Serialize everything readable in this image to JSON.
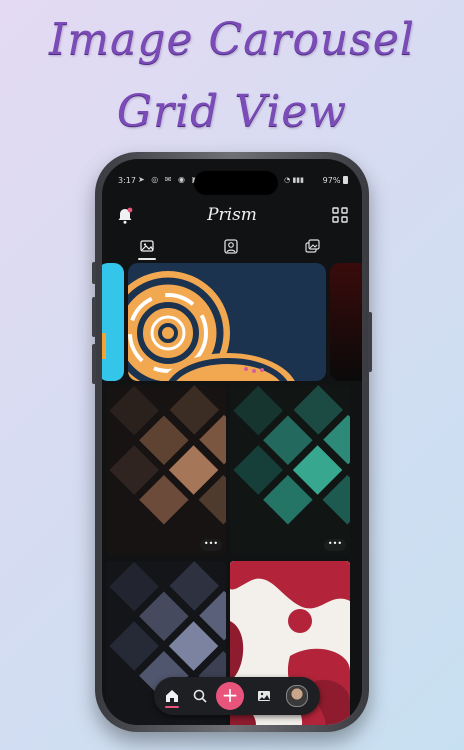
{
  "hero": {
    "line1": "Image Carousel",
    "line2": "Grid View"
  },
  "status_bar": {
    "time": "3:17",
    "battery": "97%"
  },
  "app": {
    "brand": "Prism"
  },
  "colors": {
    "accent": "#e9547d",
    "hero_text": "#7b4bb8",
    "background_dark": "#111214"
  },
  "icons": {
    "bell": "bell-icon",
    "grid": "grid-view-icon",
    "tab_wallpapers": "image-icon",
    "tab_profile": "portrait-icon",
    "tab_collections": "collections-icon",
    "nav_home": "home-icon",
    "nav_search": "search-icon",
    "nav_add": "plus-icon",
    "nav_gallery": "image-edit-icon",
    "nav_profile": "avatar"
  },
  "fab": {
    "label": "+"
  },
  "more": {
    "label": "•••"
  }
}
